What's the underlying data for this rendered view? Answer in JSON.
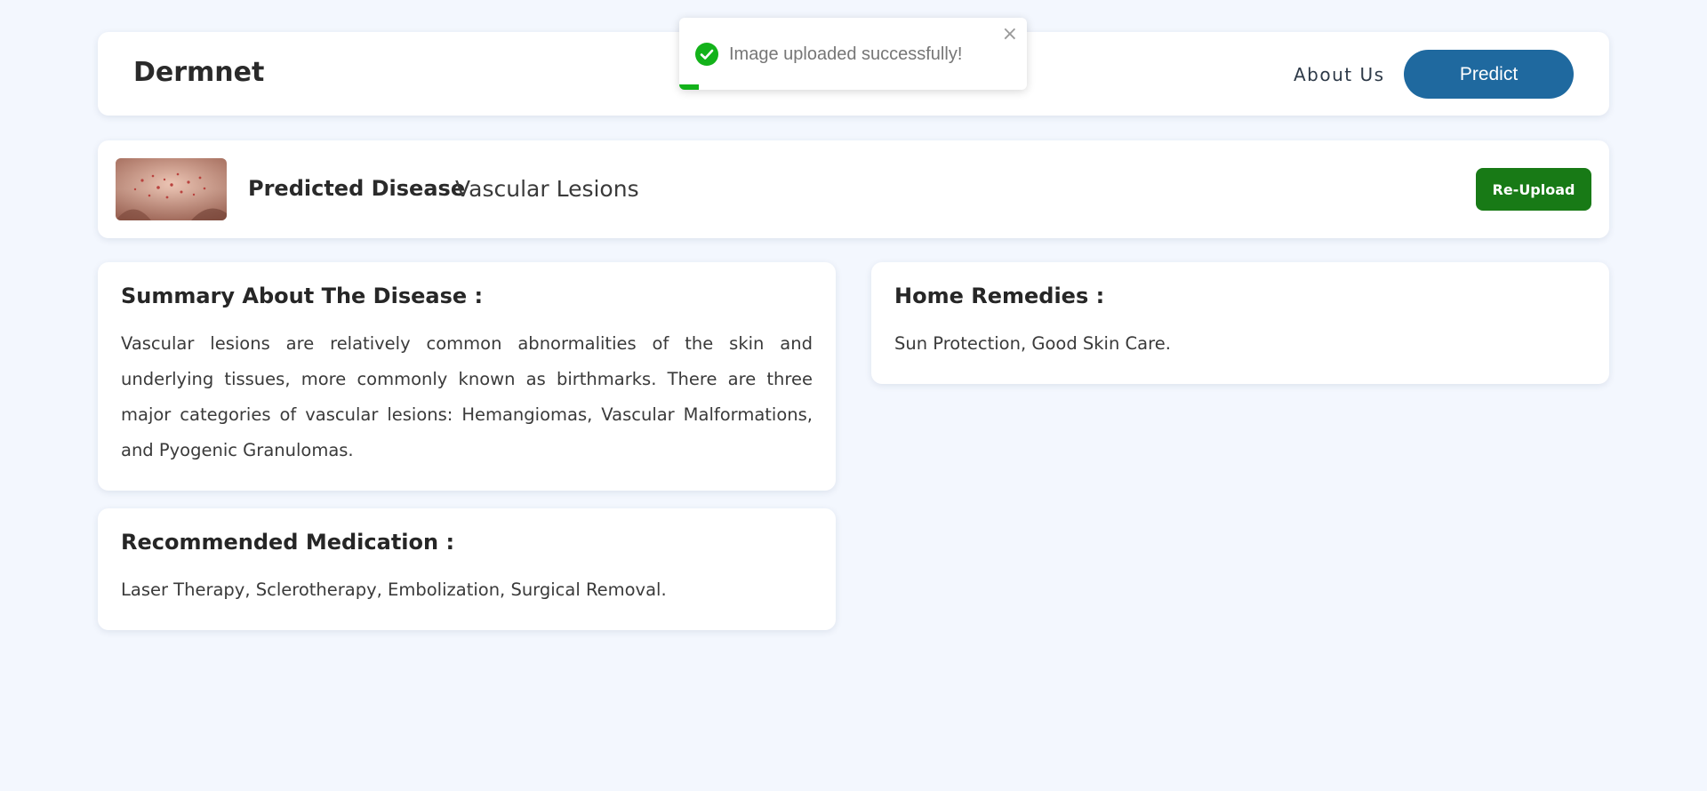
{
  "navbar": {
    "brand": "Dermnet",
    "about_label": "About Us",
    "predict_label": "Predict"
  },
  "prediction": {
    "label": "Predicted Disease",
    "value": "Vascular Lesions",
    "reupload_label": "Re-Upload"
  },
  "summary": {
    "title": "Summary About The Disease :",
    "text": "Vascular lesions are relatively common abnormalities of the skin and underlying tissues, more commonly known as birthmarks. There are three major categories of vascular lesions: Hemangiomas, Vascular Malformations, and Pyogenic Granulomas."
  },
  "remedies": {
    "title": "Home Remedies :",
    "text": "Sun Protection, Good Skin Care."
  },
  "medication": {
    "title": "Recommended Medication :",
    "text": "Laser Therapy, Sclerotherapy, Embolization, Surgical Removal."
  },
  "toast": {
    "message": "Image uploaded successfully!",
    "close_symbol": "×",
    "icon": "check-circle-icon",
    "progress": 0.055
  },
  "colors": {
    "page_bg": "#f3f7fe",
    "predict_button": "#1f699f",
    "reupload_button": "#187a16",
    "toast_success": "#13b21a"
  }
}
